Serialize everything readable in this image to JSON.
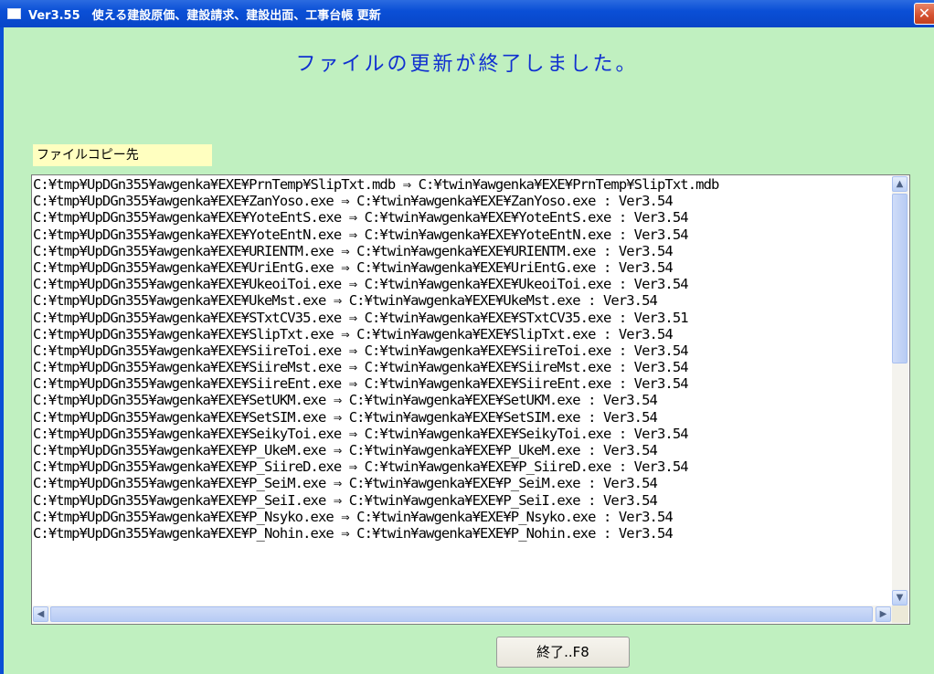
{
  "window": {
    "title": "Ver3.55　使える建設原価、建設請求、建設出面、工事台帳 更新",
    "close_glyph": "✕"
  },
  "message": "ファイルの更新が終了しました。",
  "copy_destination_label": "ファイルコピー先",
  "file_list": [
    "C:¥tmp¥UpDGn355¥awgenka¥EXE¥PrnTemp¥SlipTxt.mdb ⇒ C:¥twin¥awgenka¥EXE¥PrnTemp¥SlipTxt.mdb",
    "C:¥tmp¥UpDGn355¥awgenka¥EXE¥ZanYoso.exe ⇒ C:¥twin¥awgenka¥EXE¥ZanYoso.exe : Ver3.54",
    "C:¥tmp¥UpDGn355¥awgenka¥EXE¥YoteEntS.exe ⇒ C:¥twin¥awgenka¥EXE¥YoteEntS.exe : Ver3.54",
    "C:¥tmp¥UpDGn355¥awgenka¥EXE¥YoteEntN.exe ⇒ C:¥twin¥awgenka¥EXE¥YoteEntN.exe : Ver3.54",
    "C:¥tmp¥UpDGn355¥awgenka¥EXE¥URIENTM.exe ⇒ C:¥twin¥awgenka¥EXE¥URIENTM.exe : Ver3.54",
    "C:¥tmp¥UpDGn355¥awgenka¥EXE¥UriEntG.exe ⇒ C:¥twin¥awgenka¥EXE¥UriEntG.exe : Ver3.54",
    "C:¥tmp¥UpDGn355¥awgenka¥EXE¥UkeoiToi.exe ⇒ C:¥twin¥awgenka¥EXE¥UkeoiToi.exe : Ver3.54",
    "C:¥tmp¥UpDGn355¥awgenka¥EXE¥UkeMst.exe ⇒ C:¥twin¥awgenka¥EXE¥UkeMst.exe : Ver3.54",
    "C:¥tmp¥UpDGn355¥awgenka¥EXE¥STxtCV35.exe ⇒ C:¥twin¥awgenka¥EXE¥STxtCV35.exe : Ver3.51",
    "C:¥tmp¥UpDGn355¥awgenka¥EXE¥SlipTxt.exe ⇒ C:¥twin¥awgenka¥EXE¥SlipTxt.exe : Ver3.54",
    "C:¥tmp¥UpDGn355¥awgenka¥EXE¥SiireToi.exe ⇒ C:¥twin¥awgenka¥EXE¥SiireToi.exe : Ver3.54",
    "C:¥tmp¥UpDGn355¥awgenka¥EXE¥SiireMst.exe ⇒ C:¥twin¥awgenka¥EXE¥SiireMst.exe : Ver3.54",
    "C:¥tmp¥UpDGn355¥awgenka¥EXE¥SiireEnt.exe ⇒ C:¥twin¥awgenka¥EXE¥SiireEnt.exe : Ver3.54",
    "C:¥tmp¥UpDGn355¥awgenka¥EXE¥SetUKM.exe ⇒ C:¥twin¥awgenka¥EXE¥SetUKM.exe : Ver3.54",
    "C:¥tmp¥UpDGn355¥awgenka¥EXE¥SetSIM.exe ⇒ C:¥twin¥awgenka¥EXE¥SetSIM.exe : Ver3.54",
    "C:¥tmp¥UpDGn355¥awgenka¥EXE¥SeikyToi.exe ⇒ C:¥twin¥awgenka¥EXE¥SeikyToi.exe : Ver3.54",
    "C:¥tmp¥UpDGn355¥awgenka¥EXE¥P_UkeM.exe ⇒ C:¥twin¥awgenka¥EXE¥P_UkeM.exe : Ver3.54",
    "C:¥tmp¥UpDGn355¥awgenka¥EXE¥P_SiireD.exe ⇒ C:¥twin¥awgenka¥EXE¥P_SiireD.exe : Ver3.54",
    "C:¥tmp¥UpDGn355¥awgenka¥EXE¥P_SeiM.exe ⇒ C:¥twin¥awgenka¥EXE¥P_SeiM.exe : Ver3.54",
    "C:¥tmp¥UpDGn355¥awgenka¥EXE¥P_SeiI.exe ⇒ C:¥twin¥awgenka¥EXE¥P_SeiI.exe : Ver3.54",
    "C:¥tmp¥UpDGn355¥awgenka¥EXE¥P_Nsyko.exe ⇒ C:¥twin¥awgenka¥EXE¥P_Nsyko.exe : Ver3.54",
    "C:¥tmp¥UpDGn355¥awgenka¥EXE¥P_Nohin.exe ⇒ C:¥twin¥awgenka¥EXE¥P_Nohin.exe : Ver3.54"
  ],
  "scroll": {
    "up_glyph": "▲",
    "down_glyph": "▼",
    "left_glyph": "◀",
    "right_glyph": "▶"
  },
  "exit_button_label": "終了..F8",
  "colors": {
    "background": "#c0f0c0",
    "message_text": "#1030d0",
    "label_background": "#ffffc0"
  }
}
